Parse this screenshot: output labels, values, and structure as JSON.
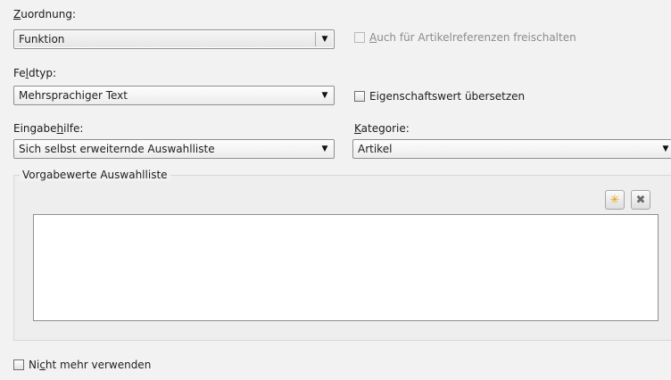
{
  "assignment": {
    "label_prefix": "",
    "label_mnemonic": "Z",
    "label_rest": "uordnung:",
    "value": "Funktion"
  },
  "article_refs": {
    "label_prefix": "",
    "label_mnemonic": "A",
    "label_rest": "uch für Artikelreferenzen freischalten",
    "checked": false,
    "enabled": false
  },
  "field_type": {
    "label_prefix": "Fe",
    "label_mnemonic": "l",
    "label_rest": "dtyp:",
    "value": "Mehrsprachiger Text"
  },
  "translate_property": {
    "label": "Eigenschaftswert übersetzen",
    "checked": false
  },
  "input_help": {
    "label_prefix": "Eingabe",
    "label_mnemonic": "h",
    "label_rest": "ilfe:",
    "value": "Sich selbst erweiternde Auswahlliste"
  },
  "category": {
    "label_prefix": "",
    "label_mnemonic": "K",
    "label_rest": "ategorie:",
    "value": "Artikel"
  },
  "default_values": {
    "title": "Vorgabewerte Auswahlliste",
    "add_icon": "star-add-icon",
    "delete_icon": "delete-x-icon",
    "add_glyph": "✳",
    "delete_glyph": "✖",
    "items": []
  },
  "deprecated": {
    "label_prefix": "Ni",
    "label_mnemonic": "c",
    "label_rest": "ht mehr verwenden",
    "checked": false
  },
  "dropdown_glyph": "▼"
}
